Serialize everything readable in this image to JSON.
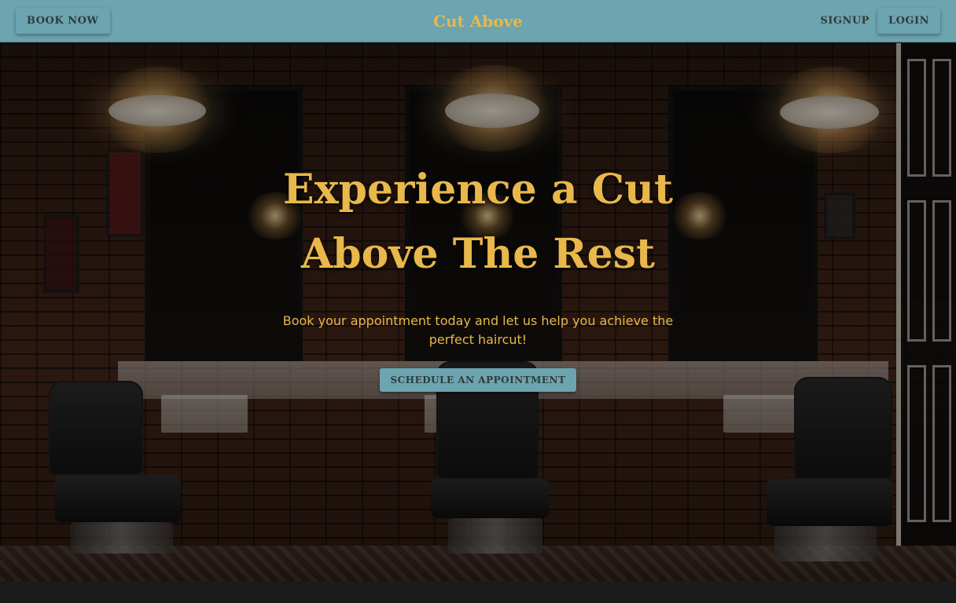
{
  "navbar": {
    "book_now": "BOOK NOW",
    "brand": "Cut Above",
    "signup": "SIGNUP",
    "login": "LOGIN"
  },
  "hero": {
    "headline": "Experience a Cut Above The Rest",
    "subtext": "Book your appointment today and let us help you achieve the perfect haircut!",
    "cta": "SCHEDULE AN APPOINTMENT"
  },
  "colors": {
    "navbar_bg": "#6ca4b0",
    "accent_gold": "#e8b84b",
    "button_text": "#2f3b3b"
  }
}
